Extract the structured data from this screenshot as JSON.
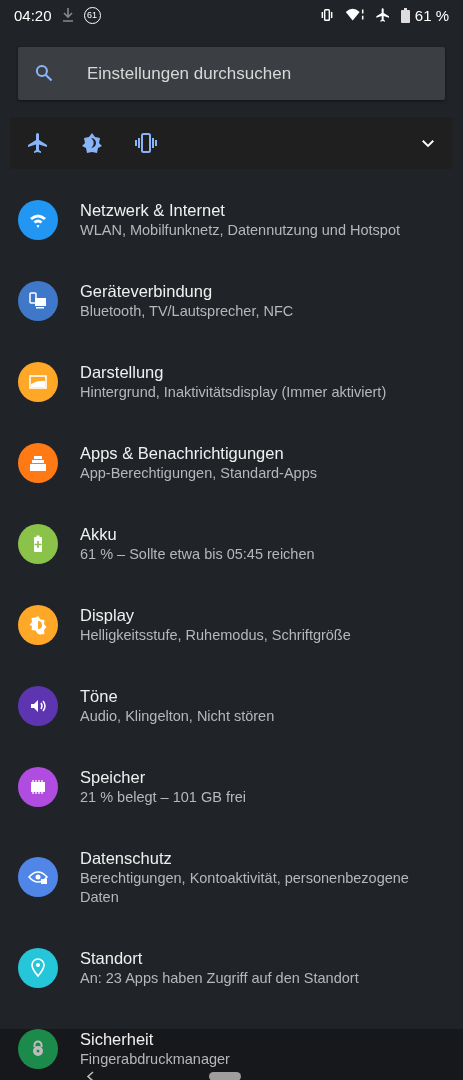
{
  "status_bar": {
    "time": "04:20",
    "notification_badge": "61",
    "battery": "61 %"
  },
  "search": {
    "placeholder": "Einstellungen durchsuchen"
  },
  "quick_settings": [
    {
      "kind": "airplane"
    },
    {
      "kind": "brightness"
    },
    {
      "kind": "vibrate"
    }
  ],
  "settings": [
    {
      "kind": "wifi",
      "color": "#2196f3",
      "title": "Netzwerk & Internet",
      "subtitle": "WLAN, Mobilfunknetz, Datennutzung und Hotspot"
    },
    {
      "kind": "devices",
      "color": "#3f78c8",
      "title": "Geräteverbindung",
      "subtitle": "Bluetooth, TV/Lautsprecher, NFC"
    },
    {
      "kind": "wallpaper",
      "color": "#ffa726",
      "title": "Darstellung",
      "subtitle": "Hintergrund, Inaktivitätsdisplay (Immer aktiviert)"
    },
    {
      "kind": "apps",
      "color": "#ff7a14",
      "title": "Apps & Benachrichtigungen",
      "subtitle": "App-Berechtigungen, Standard-Apps"
    },
    {
      "kind": "battery",
      "color": "#8bc34a",
      "title": "Akku",
      "subtitle": "61 % – Sollte etwa bis 05:45 reichen"
    },
    {
      "kind": "display",
      "color": "#ffa726",
      "title": "Display",
      "subtitle": "Helligkeitsstufe, Ruhemodus, Schriftgröße"
    },
    {
      "kind": "sound",
      "color": "#5e35b1",
      "title": "Töne",
      "subtitle": "Audio, Klingelton, Nicht stören"
    },
    {
      "kind": "storage",
      "color": "#b04ce0",
      "title": "Speicher",
      "subtitle": "21 % belegt – 101 GB frei"
    },
    {
      "kind": "privacy",
      "color": "#4f86e8",
      "title": "Datenschutz",
      "subtitle": "Berechtigungen, Kontoaktivität, personenbezogene Daten"
    },
    {
      "kind": "location",
      "color": "#26c6da",
      "title": "Standort",
      "subtitle": "An: 23 Apps haben Zugriff auf den Standort"
    },
    {
      "kind": "security",
      "color": "#1b8a4a",
      "title": "Sicherheit",
      "subtitle": "Fingerabdruckmanager"
    }
  ]
}
